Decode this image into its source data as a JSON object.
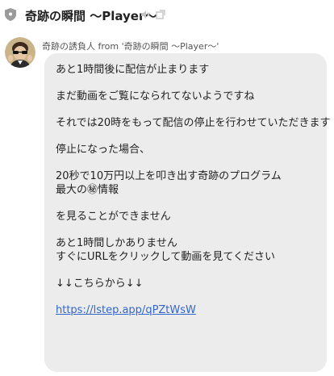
{
  "header": {
    "title": "奇跡の瞬間 〜Player〜",
    "icons": [
      "shield-icon",
      "mute-icon",
      "popout-icon"
    ]
  },
  "message": {
    "sender": "奇跡の誘負人 from '奇跡の瞬間 〜Player〜'",
    "lines": [
      "あと1時間後に配信が止まります",
      "まだ動画をご覧になられてないようですね",
      "それでは20時をもって配信の停止を行わせていただきます",
      "停止になった場合、",
      "20秒で10万円以上を叩き出す奇跡のプログラム",
      "最大の㊙情報",
      "を見ることができません",
      "あと1時間しかありません",
      "すぐにURLをクリックして動画を見てください",
      "↓↓こちらから↓↓"
    ],
    "link": "https://lstep.app/qPZtWsW"
  },
  "colors": {
    "bubble": "#ececec",
    "link": "#3366cc",
    "text": "#222222"
  }
}
